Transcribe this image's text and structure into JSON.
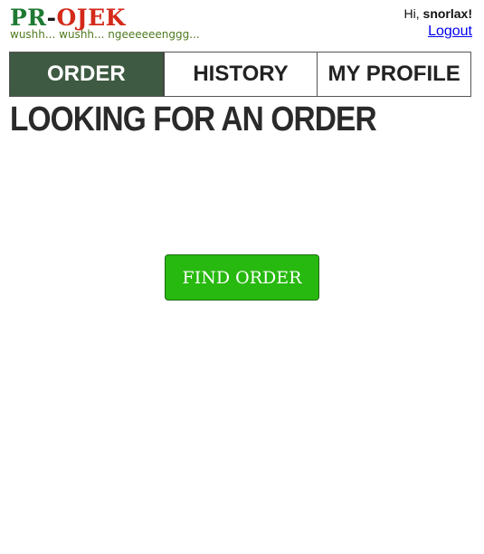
{
  "header": {
    "logo": {
      "part1": "PR",
      "dash": "-",
      "part2": "OJEK"
    },
    "tagline": "wushh... wushh... ngeeeeeenggg...",
    "greeting_prefix": "Hi, ",
    "username": "snorlax!",
    "logout_label": "Logout"
  },
  "nav": {
    "tabs": [
      {
        "label": "ORDER",
        "active": true
      },
      {
        "label": "HISTORY",
        "active": false
      },
      {
        "label": "MY PROFILE",
        "active": false
      }
    ]
  },
  "main": {
    "title": "LOOKING FOR AN ORDER",
    "find_button_label": "FIND ORDER"
  },
  "colors": {
    "logo_pr": "#1e7a32",
    "logo_ojek": "#d42a1a",
    "tagline": "#4f7a1e",
    "active_tab": "#3e5a42",
    "find_button": "#27b90f",
    "link": "#0000ee"
  }
}
